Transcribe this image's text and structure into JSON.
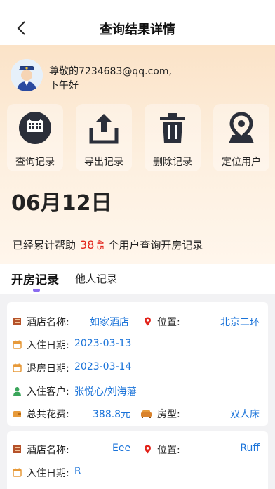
{
  "nav": {
    "title": "查询结果详情"
  },
  "user": {
    "greeting_line1": "尊敬的7234683@qq.com,",
    "greeting_line2": "下午好"
  },
  "actions": [
    {
      "label": "查询记录",
      "icon": "hotel-icon"
    },
    {
      "label": "导出记录",
      "icon": "export-icon"
    },
    {
      "label": "删除记录",
      "icon": "trash-icon"
    },
    {
      "label": "定位用户",
      "icon": "location-icon"
    }
  ],
  "date": "06月12日",
  "stats": {
    "prefix": "已经累计帮助",
    "count": "38",
    "count_tail": "45",
    "suffix": "个用户查询开房记录"
  },
  "tabs": {
    "active": "开房记录",
    "other": "他人记录"
  },
  "labels": {
    "hotel": "酒店名称:",
    "location": "位置:",
    "checkin": "入住日期:",
    "checkout": "退房日期:",
    "guests": "入住客户:",
    "cost": "总共花费:",
    "room_type": "房型:"
  },
  "records": [
    {
      "hotel": "如家酒店",
      "location": "北京二环",
      "checkin": "2023-03-13",
      "checkout": "2023-03-14",
      "guests": "张悦心/刘海藩",
      "cost": "388.8元",
      "room_type": "双人床"
    },
    {
      "hotel": "Eee",
      "location": "Ruff",
      "checkin": "R"
    }
  ],
  "colors": {
    "accent": "#1a73d9",
    "highlight": "#e2231a",
    "indicator": "#8b6cf0"
  }
}
